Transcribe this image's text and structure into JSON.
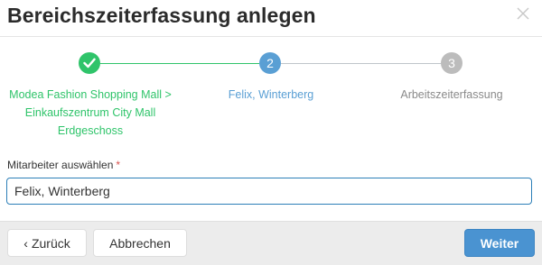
{
  "dialog": {
    "title": "Bereichszeiterfassung anlegen",
    "close_icon": "close-icon"
  },
  "wizard": {
    "steps": [
      {
        "number": "1",
        "status": "completed",
        "label_lines": [
          "Modea Fashion Shopping Mall >",
          "Einkaufszentrum City Mall",
          "Erdgeschoss"
        ]
      },
      {
        "number": "2",
        "status": "active",
        "label": "Felix, Winterberg"
      },
      {
        "number": "3",
        "status": "pending",
        "label": "Arbeitszeiterfassung"
      }
    ],
    "colors": {
      "completed": "#2fc46a",
      "active": "#5a9fd4",
      "pending": "#bcbcbc"
    }
  },
  "form": {
    "employee_label": "Mitarbeiter auswählen",
    "required_marker": "*",
    "employee_value": "Felix, Winterberg"
  },
  "footer": {
    "back_chevron": "‹",
    "back_label": "Zurück",
    "cancel_label": "Abbrechen",
    "next_label": "Weiter"
  }
}
